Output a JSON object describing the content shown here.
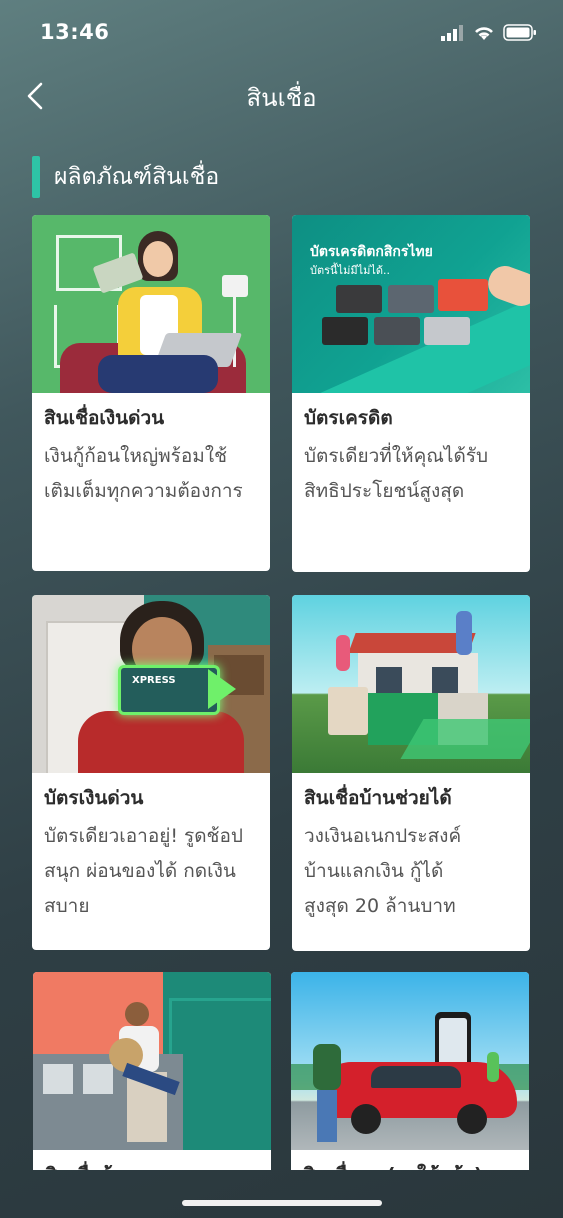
{
  "status": {
    "time": "13:46"
  },
  "nav": {
    "title": "สินเชื่อ",
    "back_icon": "chevron-left-icon"
  },
  "section": {
    "title": "ผลิตภัณฑ์สินเชื่อ",
    "accent": "#2ec4a6"
  },
  "cards": [
    {
      "title": "สินเชื่อเงินด่วน",
      "desc1": "เงินกู้ก้อนใหญ่พร้อมใช้",
      "desc2": "เติมเต็มทุกความต้องการ",
      "desc3": ""
    },
    {
      "title": "บัตรเครดิต",
      "desc1": "บัตรเดียวที่ให้คุณได้รับ",
      "desc2": "สิทธิประโยชน์สูงสุด",
      "desc3": "",
      "img_text1": "บัตรเครดิตกสิกรไทย",
      "img_text2": "บัตรนี้ไม่มีไม่ได้.."
    },
    {
      "title": "บัตรเงินด่วน",
      "desc1": "บัตรเดียวเอาอยู่! รูดช้อป",
      "desc2": "สนุก ผ่อนของได้ กดเงิน",
      "desc3": "สบาย",
      "img_text1": "XPRESS"
    },
    {
      "title": "สินเชื่อบ้านช่วยได้",
      "desc1": "วงเงินอเนกประสงค์",
      "desc2": "บ้านแลกเงิน กู้ได้",
      "desc3": "สูงสุด 20 ล้านบาท"
    },
    {
      "title": "สินเชื่อบ้าน",
      "desc1": "",
      "desc2": "",
      "desc3": ""
    },
    {
      "title": "สินเชื่อรถ (รถใช้แล้ว)",
      "desc1": "",
      "desc2": "",
      "desc3": ""
    }
  ]
}
